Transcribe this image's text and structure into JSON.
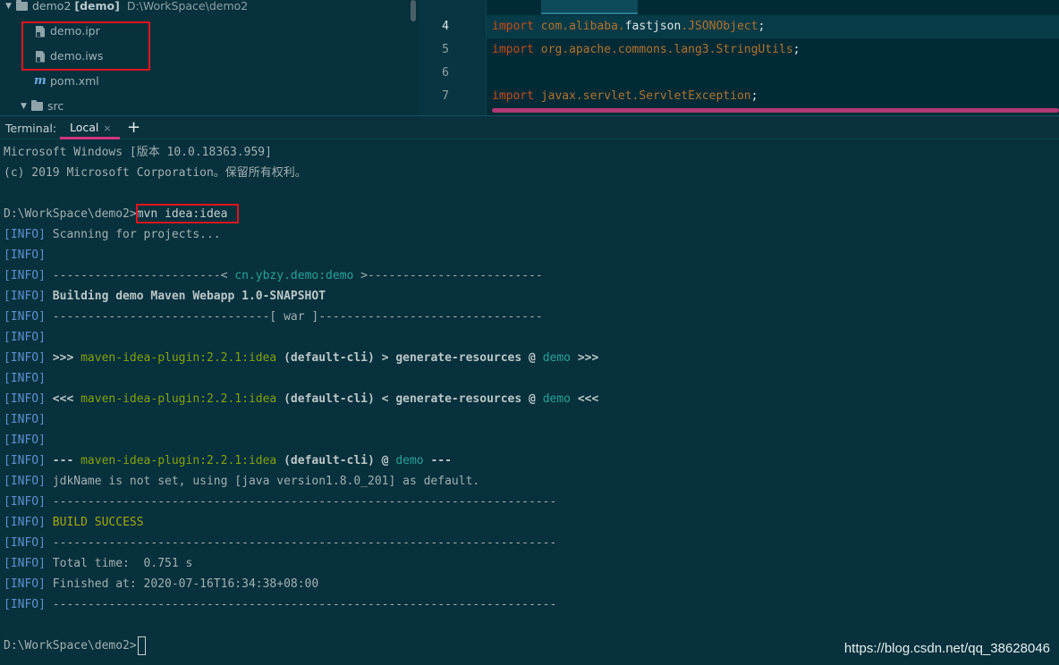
{
  "project_tree": {
    "root": {
      "name": "demo2",
      "module": "[demo]",
      "path": "D:\\WorkSpace\\demo2"
    },
    "items": [
      {
        "label": "demo.ipr",
        "icon": "file-icon"
      },
      {
        "label": "demo.iws",
        "icon": "file-icon"
      },
      {
        "label": "pom.xml",
        "icon": "maven-icon"
      },
      {
        "label": "src",
        "icon": "folder-icon"
      }
    ]
  },
  "editor": {
    "lines": [
      {
        "num": "4",
        "kw": "import",
        "pkg": "com.alibaba.",
        "hl": "fastjson",
        "rest": ".JSONObject",
        "end": ";"
      },
      {
        "num": "5",
        "kw": "import",
        "pkg": "org.apache.commons.lang3.StringUtils",
        "end": ";"
      },
      {
        "num": "6"
      },
      {
        "num": "7",
        "kw": "import",
        "pkg": "javax.servlet.ServletException",
        "end": ";"
      }
    ]
  },
  "terminal": {
    "label": "Terminal:",
    "tab": "Local",
    "close": "×",
    "add": "+",
    "header1": "Microsoft Windows [版本 10.0.18363.959]",
    "header2": "(c) 2019 Microsoft Corporation。保留所有权利。",
    "prompt": "D:\\WorkSpace\\demo2>",
    "command": "mvn idea:idea",
    "tag": "[INFO]",
    "scanning": " Scanning for projects...",
    "sep_left": " ------------------------< ",
    "artifact": "cn.ybzy.demo:demo",
    "sep_right": " >-------------------------",
    "building": " Building demo Maven Webapp 1.0-SNAPSHOT",
    "war_line": " -------------------------------[ war ]--------------------------------",
    "gt": " >>> ",
    "lt": " <<< ",
    "plugin": "maven-idea-plugin:2.2.1:idea",
    "default_cli": " (default-cli)",
    "gen_fwd": " > generate-resources @ ",
    "gen_back": " < generate-resources @ ",
    "demo": "demo",
    "tail_gt": " >>>",
    "tail_lt": " <<<",
    "dash3": " --- ",
    "at": " @ ",
    "tail_dash3": " ---",
    "jdk": " jdkName is not set, using [java version1.8.0_201] as default.",
    "long_sep": " ------------------------------------------------------------------------",
    "build_success": "BUILD SUCCESS",
    "total_time": " Total time:  0.751 s",
    "finished": " Finished at: 2020-07-16T16:34:38+08:00",
    "final_prompt": "D:\\WorkSpace\\demo2>"
  },
  "watermark": "https://blog.csdn.net/qq_38628046",
  "colors": {
    "annotation_box": "#e0141e",
    "tab_underline": "#d33682"
  }
}
